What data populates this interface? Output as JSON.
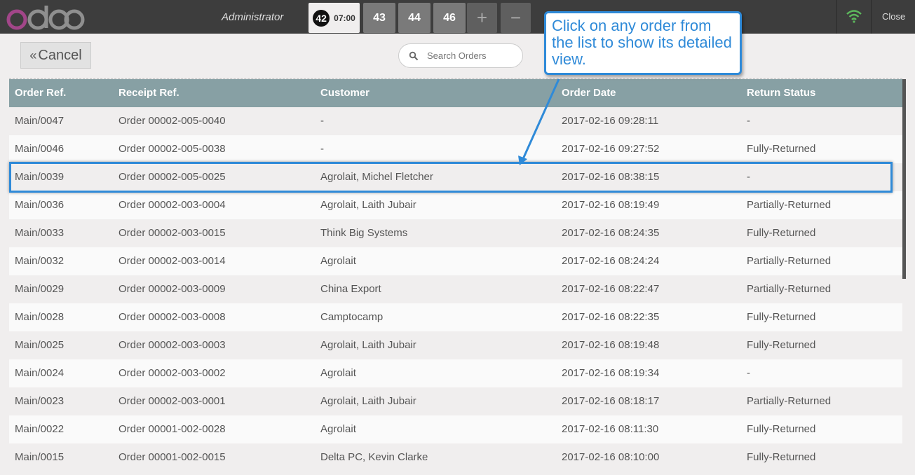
{
  "header": {
    "logo": "odoo",
    "user": "Administrator",
    "active_order": {
      "number": "42",
      "time": "07:00"
    },
    "order_tabs": [
      "43",
      "44",
      "46"
    ],
    "add_label": "+",
    "remove_label": "−",
    "close_label": "Close",
    "wifi_color": "#5cb85c"
  },
  "toolbar": {
    "cancel_icon": "«",
    "cancel_label": "Cancel",
    "search_placeholder": "Search Orders"
  },
  "table": {
    "columns": [
      "Order Ref.",
      "Receipt Ref.",
      "Customer",
      "Order Date",
      "Return Status"
    ],
    "rows": [
      [
        "Main/0047",
        "Order 00002-005-0040",
        "-",
        "2017-02-16 09:28:11",
        "-"
      ],
      [
        "Main/0046",
        "Order 00002-005-0038",
        "-",
        "2017-02-16 09:27:52",
        "Fully-Returned"
      ],
      [
        "Main/0039",
        "Order 00002-005-0025",
        "Agrolait, Michel Fletcher",
        "2017-02-16 08:38:15",
        "-"
      ],
      [
        "Main/0036",
        "Order 00002-003-0004",
        "Agrolait, Laith Jubair",
        "2017-02-16 08:19:49",
        "Partially-Returned"
      ],
      [
        "Main/0033",
        "Order 00002-003-0015",
        "Think Big Systems",
        "2017-02-16 08:24:35",
        "Fully-Returned"
      ],
      [
        "Main/0032",
        "Order 00002-003-0014",
        "Agrolait",
        "2017-02-16 08:24:24",
        "Partially-Returned"
      ],
      [
        "Main/0029",
        "Order 00002-003-0009",
        "China Export",
        "2017-02-16 08:22:47",
        "Partially-Returned"
      ],
      [
        "Main/0028",
        "Order 00002-003-0008",
        "Camptocamp",
        "2017-02-16 08:22:35",
        "Fully-Returned"
      ],
      [
        "Main/0025",
        "Order 00002-003-0003",
        "Agrolait, Laith Jubair",
        "2017-02-16 08:19:48",
        "Fully-Returned"
      ],
      [
        "Main/0024",
        "Order 00002-003-0002",
        "Agrolait",
        "2017-02-16 08:19:34",
        "-"
      ],
      [
        "Main/0023",
        "Order 00002-003-0001",
        "Agrolait, Laith Jubair",
        "2017-02-16 08:18:17",
        "Partially-Returned"
      ],
      [
        "Main/0022",
        "Order 00001-002-0028",
        "Agrolait",
        "2017-02-16 08:11:30",
        "Fully-Returned"
      ],
      [
        "Main/0015",
        "Order 00001-002-0015",
        "Delta PC, Kevin Clarke",
        "2017-02-16 08:10:00",
        "Fully-Returned"
      ]
    ]
  },
  "callout": {
    "text": "Click on any order from the list to show its detailed view.",
    "color": "#2f8ad8"
  },
  "colors": {
    "header_bg": "#3d3d3d",
    "table_header": "#87a0a4",
    "row_alt": "#f0eeee",
    "row_plain": "#fafafa"
  }
}
